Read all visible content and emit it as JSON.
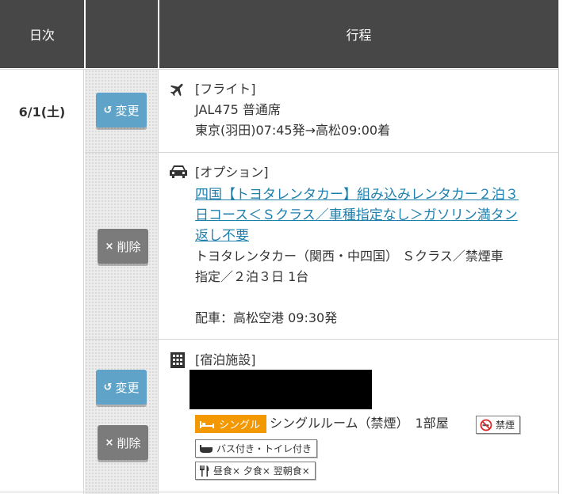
{
  "header": {
    "day_label": "日次",
    "itinerary_label": "行程"
  },
  "day": {
    "date": "6/1(土)"
  },
  "buttons": {
    "change_label": "変更",
    "delete_label": "削除"
  },
  "flight": {
    "category": "[フライト]",
    "flight_no": "JAL475 普通席",
    "route": "東京(羽田)07:45発→高松09:00着"
  },
  "option": {
    "category": "[オプション]",
    "link_lines": [
      "四国【トヨタレンタカー】組み込みレンタカー２泊３",
      "日コース＜Ｓクラス／車種指定なし＞ガソリン満タン",
      "返し不要"
    ],
    "detail_lines": [
      "トヨタレンタカー（関西・中四国） Ｓクラス／禁煙車",
      "指定／２泊３日 1台"
    ],
    "pickup": "配車：高松空港 09:30発"
  },
  "hotel": {
    "category": "[宿泊施設]",
    "room_tag": "シングル",
    "room_desc": "シングルルーム（禁煙）　1部屋",
    "smoking_badge": "禁煙",
    "amenities": "バス付き・トイレ付き",
    "meals": "昼食×  夕食×  翌朝食×"
  },
  "colors": {
    "header_bg": "#474747",
    "change_button": "#5fa4c8",
    "delete_button": "#7b7b7b",
    "room_tag": "#f39800",
    "link": "#1e7fad"
  }
}
